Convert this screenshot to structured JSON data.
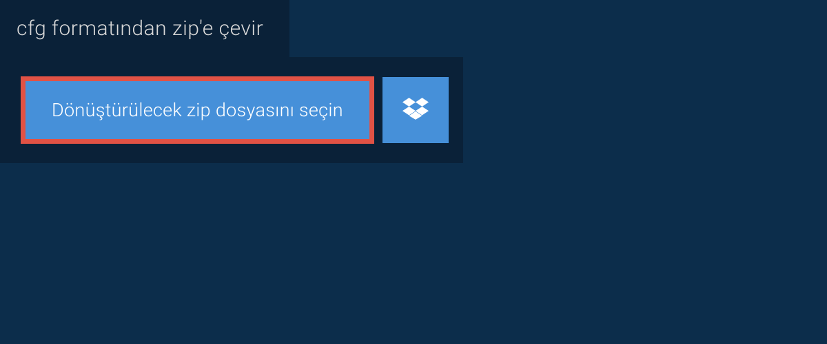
{
  "header": {
    "title": "cfg formatından zip'e çevir"
  },
  "upload": {
    "select_file_label": "Dönüştürülecek zip dosyasını seçin",
    "dropbox_icon_name": "dropbox-icon"
  },
  "colors": {
    "background": "#0c2d4b",
    "panel": "#0a2138",
    "button": "#4690d9",
    "button_border": "#e15245",
    "text_light": "#d8d8d8",
    "text_white": "#ffffff"
  }
}
